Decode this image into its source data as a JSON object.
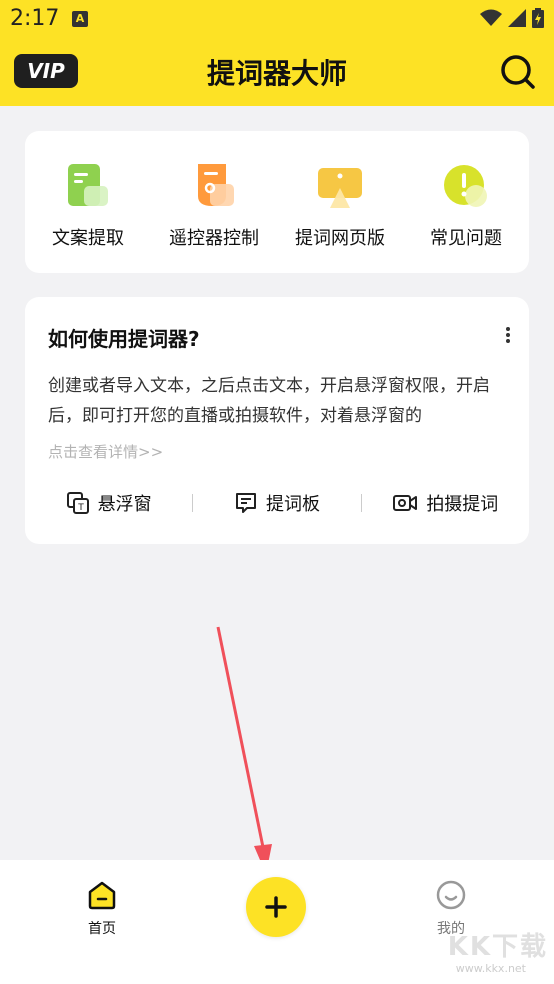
{
  "status": {
    "time": "2:17",
    "badge": "A"
  },
  "header": {
    "vip_label": "VIP",
    "title": "提词器大师"
  },
  "features": [
    {
      "label": "文案提取",
      "icon": "document-extract-icon",
      "color": "#8fd14f"
    },
    {
      "label": "遥控器控制",
      "icon": "remote-control-icon",
      "color": "#ff9a3c"
    },
    {
      "label": "提词网页版",
      "icon": "web-version-icon",
      "color": "#f6c744"
    },
    {
      "label": "常见问题",
      "icon": "faq-icon",
      "color": "#d8e22b"
    }
  ],
  "guide": {
    "title": "如何使用提词器?",
    "text": "创建或者导入文本，之后点击文本，开启悬浮窗权限，开启后，即可打开您的直播或拍摄软件，对着悬浮窗的",
    "link": "点击查看详情>>",
    "actions": [
      {
        "label": "悬浮窗",
        "icon": "floating-window-icon"
      },
      {
        "label": "提词板",
        "icon": "prompt-board-icon"
      },
      {
        "label": "拍摄提词",
        "icon": "camera-prompt-icon"
      }
    ]
  },
  "tabs": {
    "home": "首页",
    "mine": "我的"
  },
  "watermark": {
    "text": "KK下载",
    "url": "www.kkx.net"
  },
  "colors": {
    "accent": "#fde225",
    "background": "#f2f2f4"
  }
}
